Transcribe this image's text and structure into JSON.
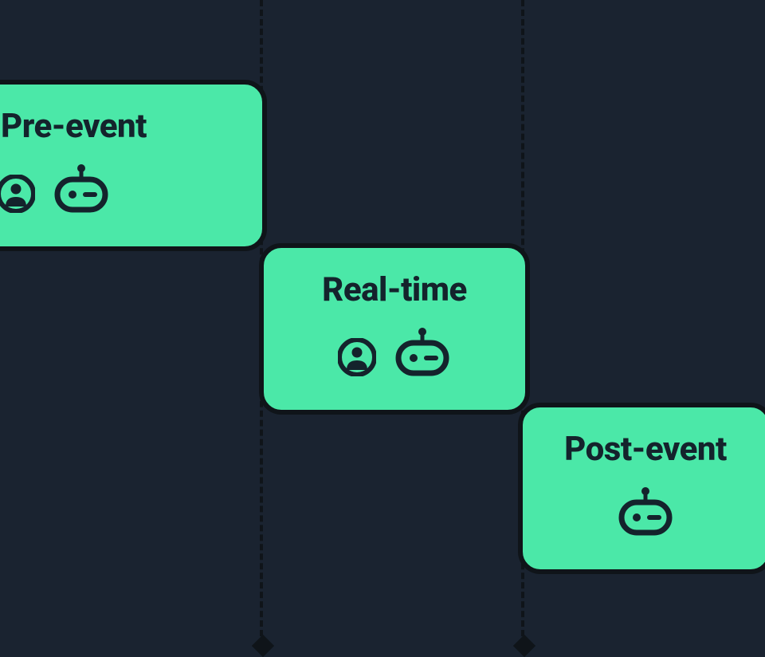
{
  "diagram": {
    "phases": [
      {
        "id": "pre-event",
        "label": "Pre-event",
        "icons": [
          "person",
          "robot"
        ]
      },
      {
        "id": "real-time",
        "label": "Real-time",
        "icons": [
          "person",
          "robot"
        ]
      },
      {
        "id": "post-event",
        "label": "Post-event",
        "icons": [
          "robot"
        ]
      }
    ],
    "timeline_markers": 2,
    "colors": {
      "card_bg": "#4be8a8",
      "stroke": "#0f1419",
      "page_bg": "#1a2330",
      "text": "#14232c"
    }
  }
}
